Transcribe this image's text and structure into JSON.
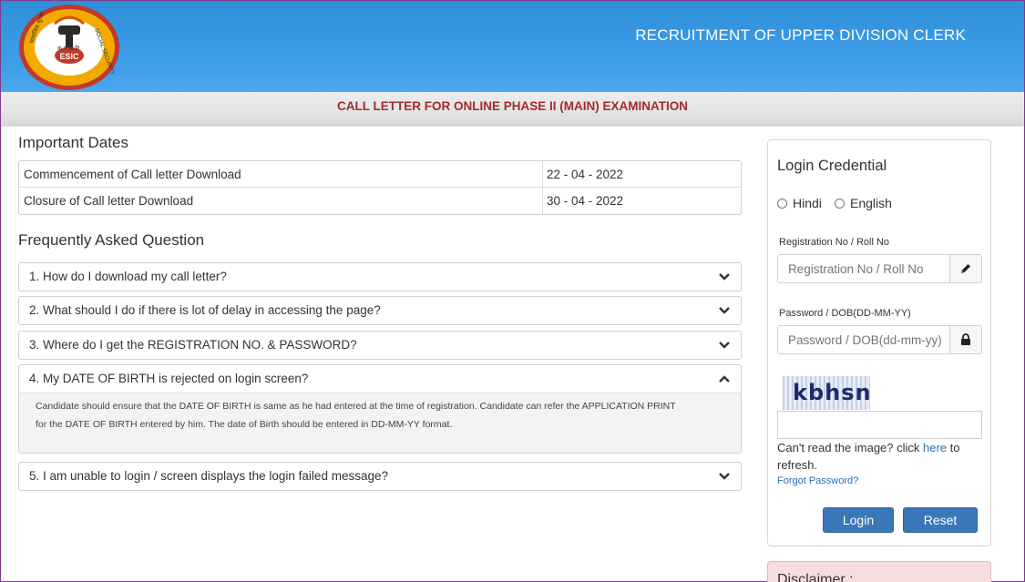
{
  "header": {
    "title": "RECRUITMENT OF UPPER DIVISION CLERK",
    "logo": {
      "hindi_top": "क.रा.बी.नि.",
      "abbr": "ESIC",
      "left_text": "सामाजिक सुरक्षा",
      "right_text": "SOCIAL SECURITY"
    }
  },
  "subheader": {
    "title": "CALL LETTER FOR ONLINE PHASE II (MAIN) EXAMINATION"
  },
  "important_dates": {
    "heading": "Important Dates",
    "rows": [
      {
        "label": "Commencement of Call letter Download",
        "value": "22 - 04 - 2022"
      },
      {
        "label": "Closure of Call letter Download",
        "value": "30 - 04 - 2022"
      }
    ]
  },
  "faq": {
    "heading": "Frequently Asked Question",
    "items": [
      {
        "question": "1. How do I download my call letter?",
        "expanded": false
      },
      {
        "question": "2. What should I do if there is lot of delay in accessing the page?",
        "expanded": false
      },
      {
        "question": "3. Where do I get the REGISTRATION NO. & PASSWORD?",
        "expanded": false
      },
      {
        "question": "4. My DATE OF BIRTH is rejected on login screen?",
        "expanded": true,
        "answer_line1": "Candidate should ensure that the DATE OF BIRTH is same as he had entered at the time of registration. Candidate can refer the APPLICATION PRINT",
        "answer_line2": "for the DATE OF BIRTH entered by him. The date of Birth should be entered in DD-MM-YY format."
      },
      {
        "question": "5. I am unable to login / screen displays the login failed message?",
        "expanded": false
      }
    ],
    "icons": {
      "collapsed": "chevron-down-icon",
      "expanded": "chevron-up-icon"
    }
  },
  "login": {
    "title": "Login Credential",
    "languages": [
      "Hindi",
      "English"
    ],
    "registration": {
      "label": "Registration No / Roll No",
      "placeholder": "Registration No / Roll No",
      "icon": "pencil-icon"
    },
    "password": {
      "label": "Password / DOB(DD-MM-YY)",
      "placeholder": "Password / DOB(dd-mm-yy)",
      "icon": "lock-icon"
    },
    "captcha": {
      "text": "kbhsn",
      "note_prefix": "Can't read the image? click ",
      "note_link": "here",
      "note_suffix": " to refresh."
    },
    "forgot": "Forgot Password?",
    "buttons": {
      "login": "Login",
      "reset": "Reset"
    }
  },
  "disclaimer": {
    "title": "Disclaimer :"
  },
  "colors": {
    "header_blue": "#3b9be6",
    "subheader_text": "#a32b2b",
    "button_blue": "#3a77b8",
    "link_blue": "#2a6ebb",
    "disclaimer_bg": "#f6dede"
  }
}
